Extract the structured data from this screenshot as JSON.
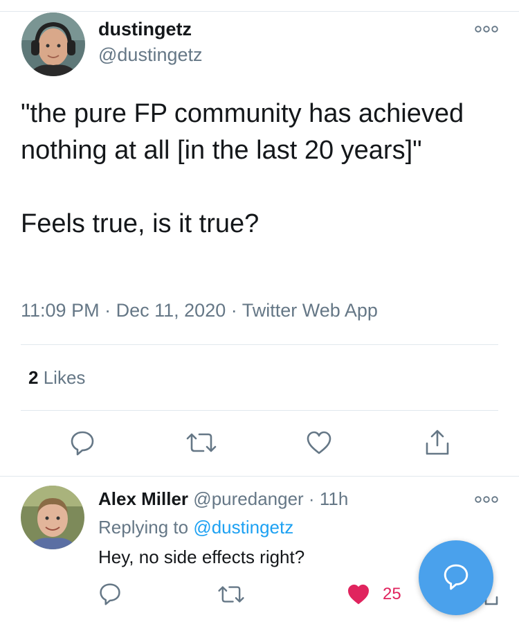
{
  "tweet": {
    "author_name": "dustingetz",
    "author_handle": "@dustingetz",
    "text": "\"the pure FP community has achieved nothing at all [in the last 20 years]\"\n\nFeels true, is it true?",
    "time": "11:09 PM",
    "date": "Dec 11, 2020",
    "source": "Twitter Web App",
    "separator": "·",
    "likes_count": "2",
    "likes_label": "Likes"
  },
  "reply": {
    "author_name": "Alex Miller",
    "author_handle": "@puredanger",
    "separator": "·",
    "age": "11h",
    "replying_prefix": "Replying to",
    "replying_to": "@dustingetz",
    "text": "Hey, no side effects right?",
    "like_count": "25"
  },
  "icons": {
    "more": "more-icon",
    "reply": "reply-icon",
    "retweet": "retweet-icon",
    "like": "heart-icon",
    "share": "share-icon",
    "compose": "compose-reply-icon"
  },
  "colors": {
    "accent": "#1da1f2",
    "secondary_text": "#657786",
    "like_red": "#e0245e",
    "fab": "#4aa1ec"
  }
}
